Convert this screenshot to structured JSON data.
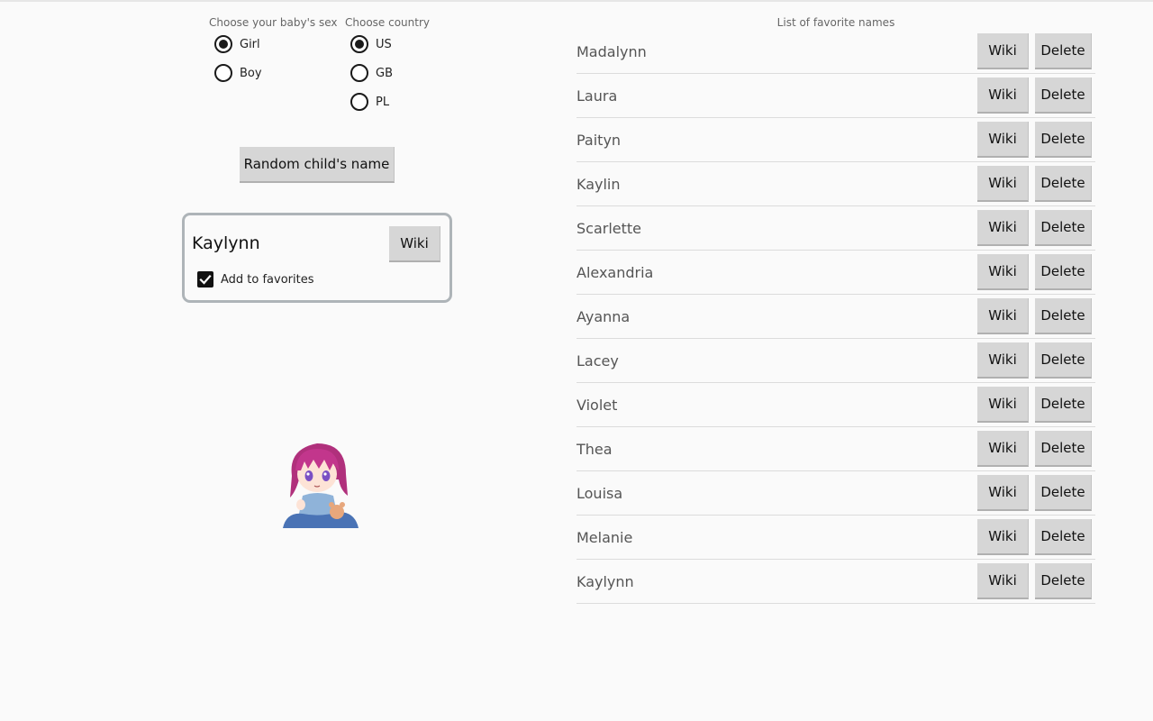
{
  "sex": {
    "label": "Choose your baby's sex",
    "options": [
      {
        "label": "Girl",
        "checked": true
      },
      {
        "label": "Boy",
        "checked": false
      }
    ]
  },
  "country": {
    "label": "Choose country",
    "options": [
      {
        "label": "US",
        "checked": true
      },
      {
        "label": "GB",
        "checked": false
      },
      {
        "label": "PL",
        "checked": false
      }
    ]
  },
  "random_button": "Random child's name",
  "result": {
    "name": "Kaylynn",
    "wiki_label": "Wiki",
    "favorite_label": "Add to favorites",
    "favorite_checked": true
  },
  "favorites": {
    "title": "List of favorite names",
    "wiki_label": "Wiki",
    "delete_label": "Delete",
    "names": [
      "Madalynn",
      "Laura",
      "Paityn",
      "Kaylin",
      "Scarlette",
      "Alexandria",
      "Ayanna",
      "Lacey",
      "Violet",
      "Thea",
      "Louisa",
      "Melanie",
      "Kaylynn"
    ]
  },
  "colors": {
    "background": "#fafafa",
    "button": "#d6d6d6",
    "card_border": "#aeb4b8"
  },
  "icons": {
    "checkbox": "check-icon",
    "mascot": "baby-girl-mascot-icon"
  }
}
